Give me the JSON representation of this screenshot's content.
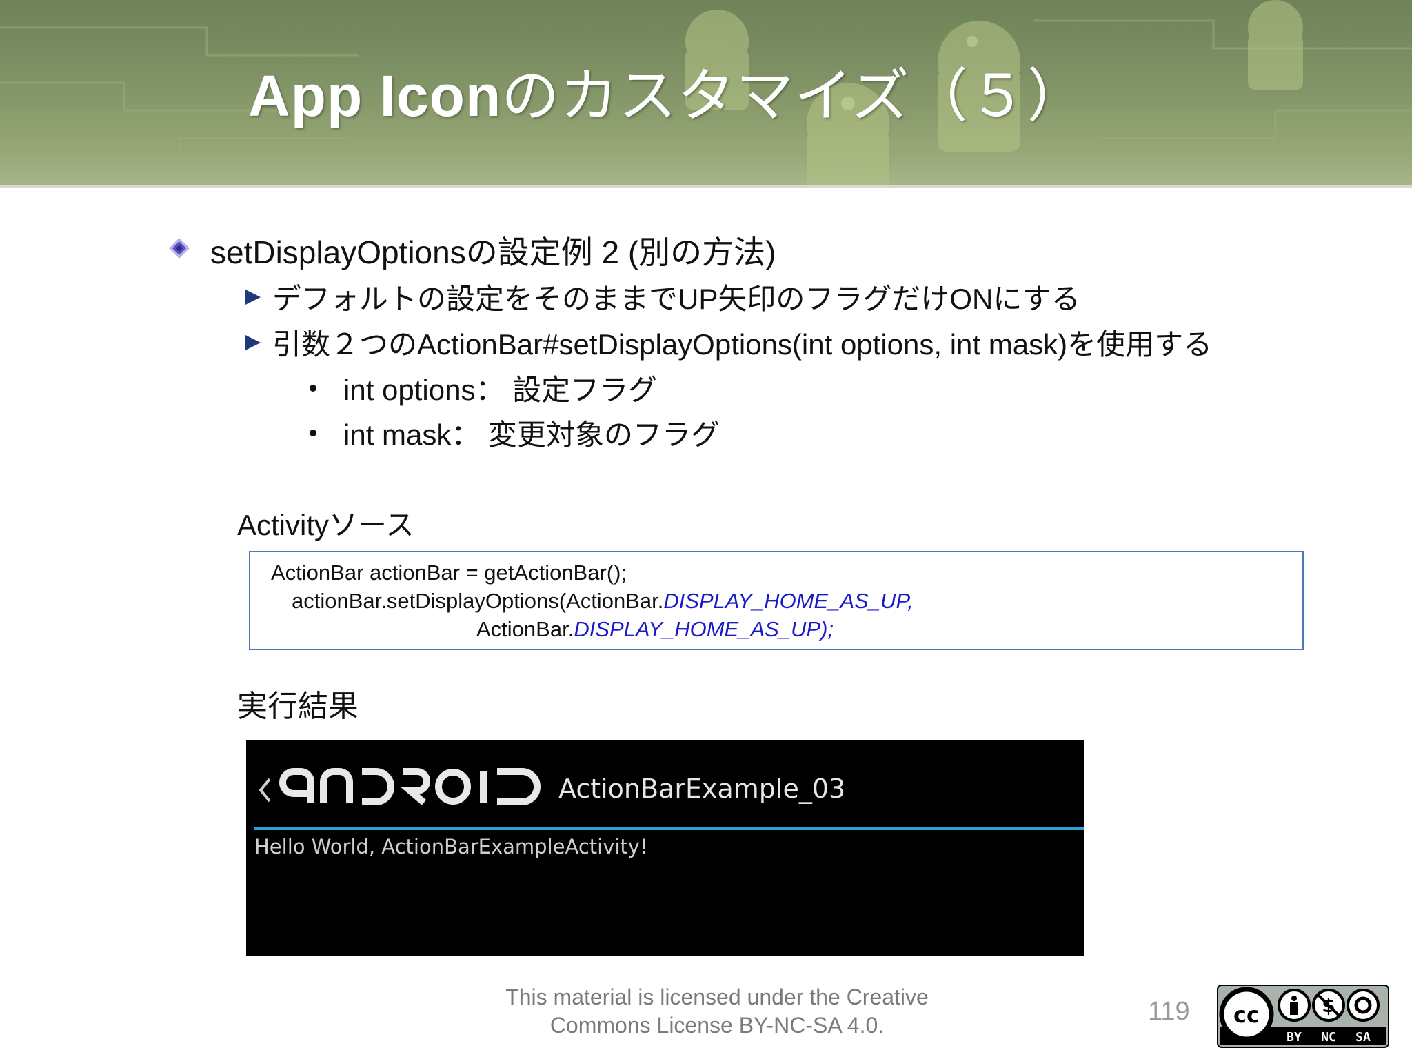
{
  "header": {
    "title_latin": "App Icon",
    "title_jp": "のカスタマイズ（５）"
  },
  "content": {
    "bullet": "setDisplayOptionsの設定例 2 (別の方法)",
    "sub_items": [
      "デフォルトの設定をそのままでUP矢印のフラグだけONにする",
      "引数２つのActionBar#setDisplayOptions(int options, int mask)を使用する"
    ],
    "params": [
      "int options： 設定フラグ",
      "int mask： 変更対象のフラグ"
    ]
  },
  "source_label": "Activityソース",
  "code": {
    "line1": "ActionBar actionBar = getActionBar();",
    "line2_prefix": "actionBar.setDisplayOptions(ActionBar.",
    "line2_const": "DISPLAY_HOME_AS_UP",
    "line2_suffix": ",",
    "line3_prefix": "ActionBar.",
    "line3_const": "DISPLAY_HOME_AS_UP",
    "line3_suffix": ");"
  },
  "result_label": "実行結果",
  "device": {
    "up_caret": "‹",
    "logo_icon": "android-wordmark-icon",
    "app_name": "ActionBarExample_03",
    "hello": "Hello World, ActionBarExampleActivity!",
    "colors": {
      "divider": "#2e9fd6",
      "background": "#000000"
    }
  },
  "footer": {
    "license_line1": "This material is licensed under the Creative",
    "license_line2": "Commons License BY-NC-SA 4.0.",
    "page_number": "119",
    "cc_labels": [
      "BY",
      "NC",
      "SA"
    ]
  },
  "colors": {
    "header": "#7c8f63",
    "code_border": "#4a78b8",
    "code_const": "#1a1ac8",
    "bullet_diamond": "#5a4fc0",
    "bullet_triangle": "#1f3a78"
  }
}
